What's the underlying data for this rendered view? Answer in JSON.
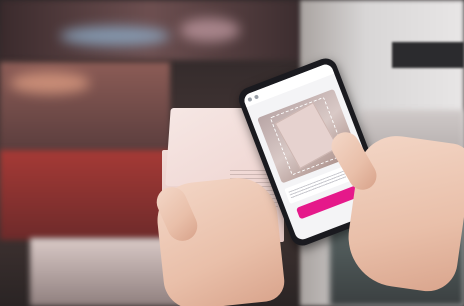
{
  "scene": {
    "store_sign_text": "",
    "phone_app": {
      "brand_text": "",
      "cta_text": ""
    },
    "colors": {
      "accent": "#e5198a",
      "skin": "#ecc6b3",
      "box": "#f1dcd8"
    }
  }
}
